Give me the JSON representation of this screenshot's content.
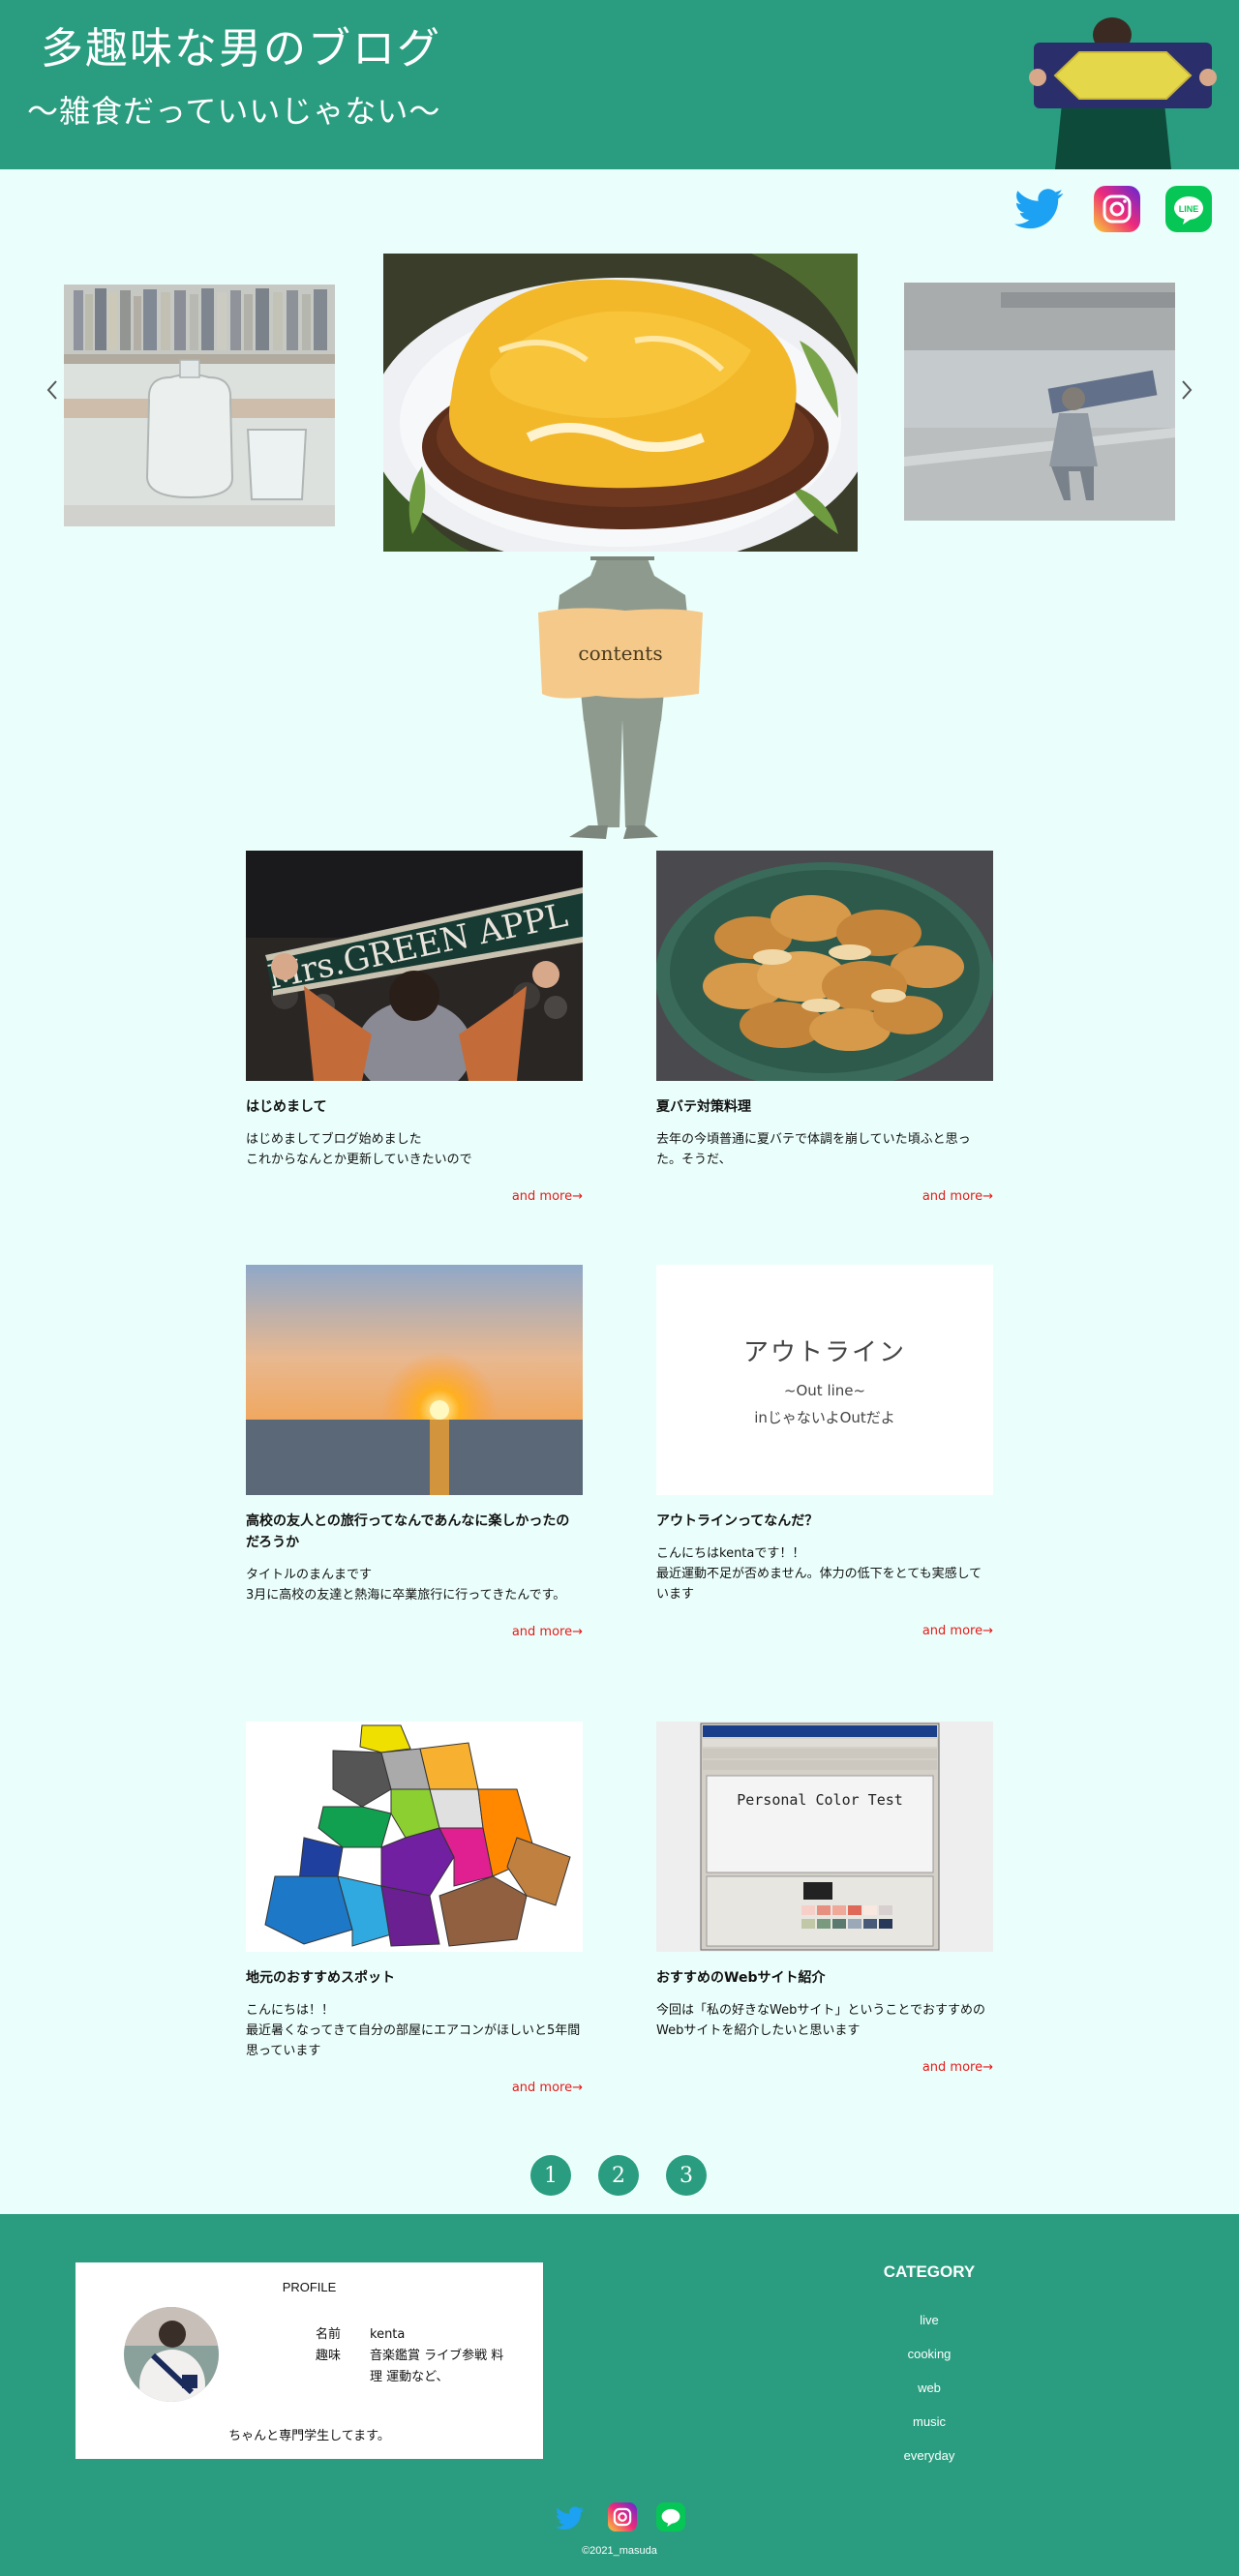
{
  "header": {
    "title": "多趣味な男のブログ",
    "subtitle": "〜雑食だっていいじゃない〜"
  },
  "social": {
    "icons": [
      "twitter-icon",
      "instagram-icon",
      "line-icon"
    ],
    "line_label": "LINE"
  },
  "carousel": {
    "prev_icon": "chevron-left-icon",
    "next_icon": "chevron-right-icon"
  },
  "contents_label": "contents",
  "posts": [
    {
      "title": "はじめまして",
      "excerpt": "はじめましてブログ始めました\nこれからなんとか更新していきたいので",
      "more": "and more→",
      "thumb_text": "Mrs.GREEN APPL"
    },
    {
      "title": "夏バテ対策料理",
      "excerpt": "去年の今頃普通に夏バテで体調を崩していた頃ふと思った。そうだ、",
      "more": "and more→"
    },
    {
      "title": "高校の友人との旅行ってなんであんなに楽しかったのだろうか",
      "excerpt": "タイトルのまんまです\n3月に高校の友達と熱海に卒業旅行に行ってきたんです。",
      "more": "and more→"
    },
    {
      "title": "アウトラインってなんだ？",
      "excerpt": "こんにちはkentaです！！\n最近運動不足が否めません。体力の低下をとても実感しています",
      "more": "and more→",
      "thumb_lines": [
        "アウトライン",
        "~Out line~",
        "inじゃないよOutだよ"
      ]
    },
    {
      "title": "地元のおすすめスポット",
      "excerpt": "こんにちは！！\n最近暑くなってきて自分の部屋にエアコンがほしいと5年間思っています",
      "more": "and more→"
    },
    {
      "title": "おすすめのWebサイト紹介",
      "excerpt": "今回は「私の好きなWebサイト」ということでおすすめのWebサイトを紹介したいと思います",
      "more": "and more→",
      "thumb_heading": "Personal Color Test"
    }
  ],
  "pagination": [
    "1",
    "2",
    "3"
  ],
  "footer": {
    "profile": {
      "heading": "PROFILE",
      "name_label": "名前",
      "name_value": "kenta",
      "hobby_label": "趣味",
      "hobby_value": "音楽鑑賞 ライブ参戦 料理 運動など、",
      "note": "ちゃんと専門学生してます。"
    },
    "category": {
      "heading": "CATEGORY",
      "items": [
        "live",
        "cooking",
        "web",
        "music",
        "everyday"
      ]
    },
    "copyright": "©2021_masuda"
  },
  "colors": {
    "brand_green": "#2a9d80",
    "background": "#eafffb",
    "more_link": "#e51a1a"
  }
}
